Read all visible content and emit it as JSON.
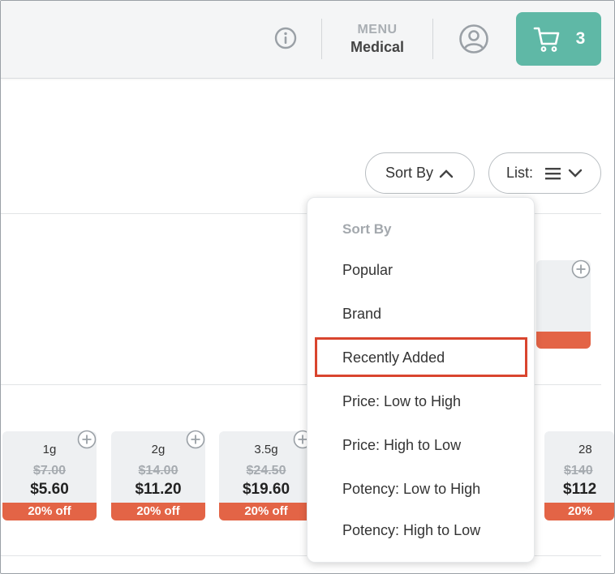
{
  "header": {
    "info_icon": "info-circle-icon",
    "menu_label": "MENU",
    "menu_value": "Medical",
    "account_icon": "user-circle-icon",
    "cart_icon": "shopping-cart-icon",
    "cart_count": "3",
    "cart_color": "#5fb8a6"
  },
  "toolbar": {
    "sort_label": "Sort By",
    "list_label": "List:"
  },
  "sort_menu": {
    "heading": "Sort By",
    "options": [
      "Popular",
      "Brand",
      "Recently Added",
      "Price: Low to High",
      "Price: High to Low",
      "Potency: Low to High",
      "Potency: High to Low"
    ],
    "highlighted": "Recently Added",
    "highlight_color": "#d9452e"
  },
  "products": [
    {
      "weight": "1g",
      "old_price": "$7.00",
      "price": "$5.60",
      "discount": "20% off"
    },
    {
      "weight": "2g",
      "old_price": "$14.00",
      "price": "$11.20",
      "discount": "20% off"
    },
    {
      "weight": "3.5g",
      "old_price": "$24.50",
      "price": "$19.60",
      "discount": "20% off"
    },
    {
      "weight": "28",
      "old_price": "$140",
      "price": "$112",
      "discount": "20%"
    }
  ],
  "accent_discount": "#e36446"
}
